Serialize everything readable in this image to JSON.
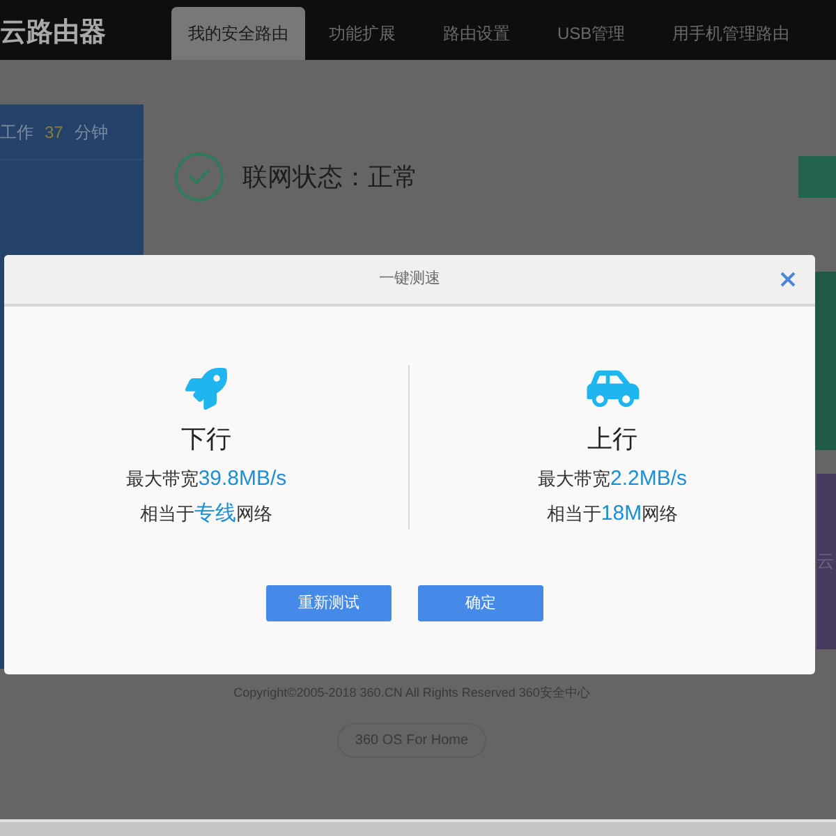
{
  "nav": {
    "logo": "云路由器",
    "tabs": [
      {
        "label": "我的安全路由",
        "selected": true
      },
      {
        "label": "功能扩展",
        "selected": false
      },
      {
        "label": "路由设置",
        "selected": false
      },
      {
        "label": "USB管理",
        "selected": false
      },
      {
        "label": "用手机管理路由",
        "selected": false
      }
    ]
  },
  "uptime": {
    "prefix": "工作",
    "value": "37",
    "unit": "分钟"
  },
  "status": {
    "label": "联网状态：正常"
  },
  "side_panel_text": "云",
  "dialog": {
    "title": "一键测速",
    "results": [
      {
        "kind": "download",
        "direction": "下行",
        "bandwidth_label": "最大带宽",
        "bandwidth_value": "39.8MB/s",
        "equiv_prefix": "相当于",
        "equiv_value": "专线",
        "equiv_suffix": "网络"
      },
      {
        "kind": "upload",
        "direction": "上行",
        "bandwidth_label": "最大带宽",
        "bandwidth_value": "2.2MB/s",
        "equiv_prefix": "相当于",
        "equiv_value": "18M",
        "equiv_suffix": "网络"
      }
    ],
    "buttons": [
      "重新测试",
      "确定"
    ]
  },
  "footer": {
    "copyright": "Copyright©2005-2018 360.CN All Rights Reserved 360安全中心",
    "badge": "360 OS For Home"
  }
}
